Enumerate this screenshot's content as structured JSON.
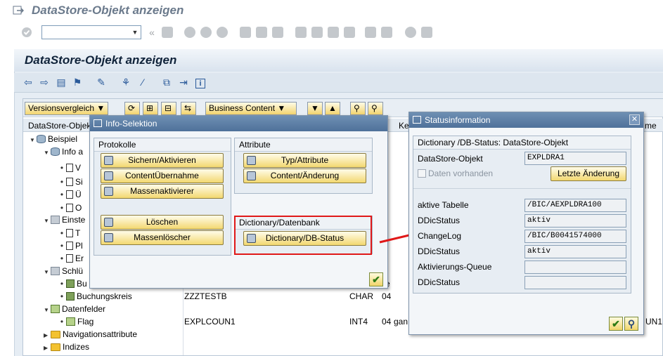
{
  "window": {
    "title": "DataStore-Objekt anzeigen"
  },
  "main": {
    "title": "DataStore-Objekt anzeigen"
  },
  "grid_toolbar": {
    "version_compare": "Versionsvergleich",
    "business_content": "Business Content"
  },
  "columns": {
    "c1": "DataStore-Objekt",
    "c2": "Ke",
    "c3": "me"
  },
  "tree": {
    "beispiel": "Beispiel",
    "info_partial": "Info a",
    "doc_rows": [
      "V",
      "Si",
      "Ü",
      "O"
    ],
    "einstellungen_partial": "Einste",
    "einst_rows": [
      "T",
      "Pl",
      "Er"
    ],
    "schluessel_partial": "Schlü",
    "key_row1_partial": "Bu",
    "buchungskreis": "Buchungskreis",
    "buchungskreis_tech": "ZZZTESTB",
    "buchungskreis_type": "CHAR",
    "buchungskreis_len": "04",
    "key1_len_partial": "e",
    "datenfelder": "Datenfelder",
    "flag": "Flag",
    "flag_tech": "EXPLCOUN1",
    "flag_type": "INT4",
    "flag_len": "04",
    "flag_extra": "gan",
    "flag_right": "UN1",
    "navigationsattribute": "Navigationsattribute",
    "indizes": "Indizes"
  },
  "info_selektion": {
    "title": "Info-Selektion",
    "protokolle": "Protokolle",
    "btn_sichern": "Sichern/Aktivieren",
    "btn_content": "ContentÜbernahme",
    "btn_masse": "Massenaktivierer",
    "btn_loeschen": "Löschen",
    "btn_massenloescher": "Massenlöscher",
    "attribute": "Attribute",
    "btn_typ": "Typ/Attribute",
    "btn_content_aend": "Content/Änderung",
    "dictionary_group": "Dictionary/Datenbank",
    "btn_dict": "Dictionary/DB-Status"
  },
  "statusinfo": {
    "title": "Statusinformation",
    "header": "Dictionary /DB-Status: DataStore-Objekt",
    "ds_label": "DataStore-Objekt",
    "ds_value": "EXPLDRA1",
    "daten_label": "Daten vorhanden",
    "letzte_btn": "Letzte Änderung",
    "aktive_label": "aktive Tabelle",
    "aktive_value": "/BIC/AEXPLDRA100",
    "ddic_label": "DDicStatus",
    "ddic1_value": "aktiv",
    "changelog_label": "ChangeLog",
    "changelog_value": "/BIC/B0041574000",
    "ddic2_value": "aktiv",
    "queue_label": "Aktivierungs-Queue",
    "queue_value": "",
    "ddic3_value": ""
  },
  "colors": {
    "arrow": "#e01818",
    "highlight": "#e01818",
    "title_bar": "#5b7ca4"
  }
}
